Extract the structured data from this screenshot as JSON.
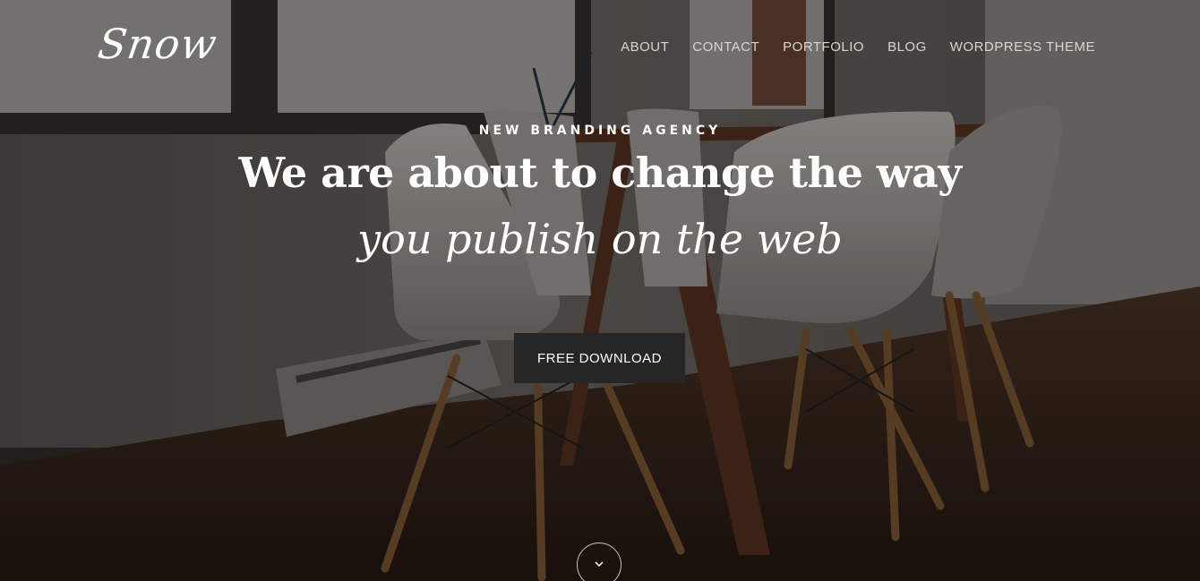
{
  "site": {
    "logo": "Snow"
  },
  "nav": {
    "items": [
      {
        "label": "ABOUT"
      },
      {
        "label": "CONTACT"
      },
      {
        "label": "PORTFOLIO"
      },
      {
        "label": "BLOG"
      },
      {
        "label": "WORDPRESS THEME"
      }
    ]
  },
  "hero": {
    "eyebrow": "NEW BRANDING AGENCY",
    "headline": "We are about to change the way",
    "subheadline": "you publish on the web",
    "cta_label": "FREE DOWNLOAD",
    "scroll_icon": "chevron-down-icon"
  },
  "colors": {
    "button_bg": "#262626",
    "text": "#ffffff",
    "nav_text": "#d9d6d2"
  }
}
